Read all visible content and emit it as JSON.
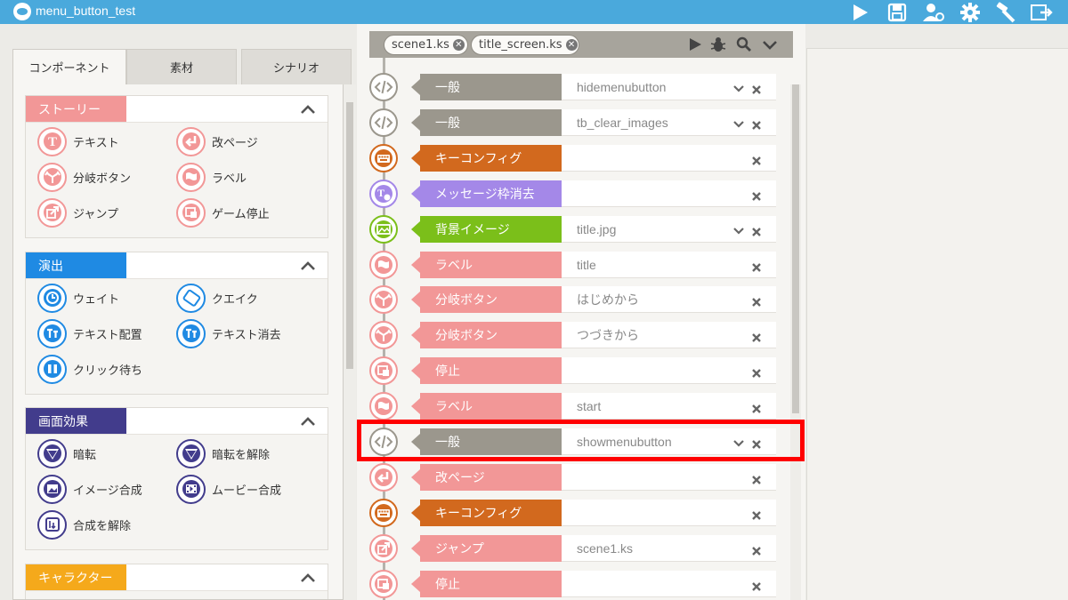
{
  "app": {
    "title": "menu_button_test"
  },
  "toolbar": {
    "icons": [
      "play-icon",
      "save-icon",
      "users-icon",
      "gear-icon",
      "hammer-icon",
      "export-icon"
    ]
  },
  "left": {
    "tabs": [
      "コンポーネント",
      "素材",
      "シナリオ"
    ],
    "sections": [
      {
        "title": "ストーリー",
        "color": "#f29797",
        "items": [
          {
            "label": "テキスト",
            "icon": "text-icon"
          },
          {
            "label": "改ページ",
            "icon": "page-break-icon"
          },
          {
            "label": "分岐ボタン",
            "icon": "branch-button-icon"
          },
          {
            "label": "ラベル",
            "icon": "label-flag-icon"
          },
          {
            "label": "ジャンプ",
            "icon": "jump-icon"
          },
          {
            "label": "ゲーム停止",
            "icon": "game-stop-icon"
          }
        ]
      },
      {
        "title": "演出",
        "color": "#1f8ae3",
        "items": [
          {
            "label": "ウェイト",
            "icon": "clock-icon"
          },
          {
            "label": "クエイク",
            "icon": "quake-icon"
          },
          {
            "label": "テキスト配置",
            "icon": "text-layout-icon"
          },
          {
            "label": "テキスト消去",
            "icon": "text-clear-icon"
          },
          {
            "label": "クリック待ち",
            "icon": "click-wait-icon"
          }
        ]
      },
      {
        "title": "画面効果",
        "color": "#423c8c",
        "items": [
          {
            "label": "暗転",
            "icon": "fade-out-icon"
          },
          {
            "label": "暗転を解除",
            "icon": "fade-in-icon"
          },
          {
            "label": "イメージ合成",
            "icon": "image-composite-icon"
          },
          {
            "label": "ムービー合成",
            "icon": "movie-composite-icon"
          },
          {
            "label": "合成を解除",
            "icon": "composite-clear-icon"
          }
        ]
      },
      {
        "title": "キャラクター",
        "color": "#f5a91b",
        "items": []
      }
    ]
  },
  "scenario": {
    "file_tabs": [
      "scene1.ks",
      "title_screen.ks"
    ],
    "rows": [
      {
        "label": "一般",
        "value": "hidemenubutton",
        "color": "#9b978d",
        "icon": "code-icon",
        "dropdown": true
      },
      {
        "label": "一般",
        "value": "tb_clear_images",
        "color": "#9b978d",
        "icon": "code-icon",
        "dropdown": true
      },
      {
        "label": "キーコンフィグ",
        "value": "",
        "color": "#d2691e",
        "icon": "keyboard-icon",
        "dropdown": false
      },
      {
        "label": "メッセージ枠消去",
        "value": "",
        "color": "#a488e8",
        "icon": "message-clear-icon",
        "dropdown": false
      },
      {
        "label": "背景イメージ",
        "value": "title.jpg",
        "color": "#7bbf1a",
        "icon": "background-image-icon",
        "dropdown": true
      },
      {
        "label": "ラベル",
        "value": "title",
        "color": "#f29797",
        "icon": "label-flag-icon",
        "dropdown": false
      },
      {
        "label": "分岐ボタン",
        "value": "はじめから",
        "color": "#f29797",
        "icon": "branch-button-icon",
        "dropdown": false
      },
      {
        "label": "分岐ボタン",
        "value": "つづきから",
        "color": "#f29797",
        "icon": "branch-button-icon",
        "dropdown": false
      },
      {
        "label": "停止",
        "value": "",
        "color": "#f29797",
        "icon": "game-stop-icon",
        "dropdown": false
      },
      {
        "label": "ラベル",
        "value": "start",
        "color": "#f29797",
        "icon": "label-flag-icon",
        "dropdown": false
      },
      {
        "label": "一般",
        "value": "showmenubutton",
        "color": "#9b978d",
        "icon": "code-icon",
        "dropdown": true
      },
      {
        "label": "改ページ",
        "value": "",
        "color": "#f29797",
        "icon": "page-break-icon",
        "dropdown": false
      },
      {
        "label": "キーコンフィグ",
        "value": "",
        "color": "#d2691e",
        "icon": "keyboard-icon",
        "dropdown": false
      },
      {
        "label": "ジャンプ",
        "value": "scene1.ks",
        "color": "#f29797",
        "icon": "jump-icon",
        "dropdown": false
      },
      {
        "label": "停止",
        "value": "",
        "color": "#f29797",
        "icon": "game-stop-icon",
        "dropdown": false
      }
    ]
  },
  "colors": {
    "titlebar": "#4aa9dc",
    "highlight": "#ff0000"
  }
}
